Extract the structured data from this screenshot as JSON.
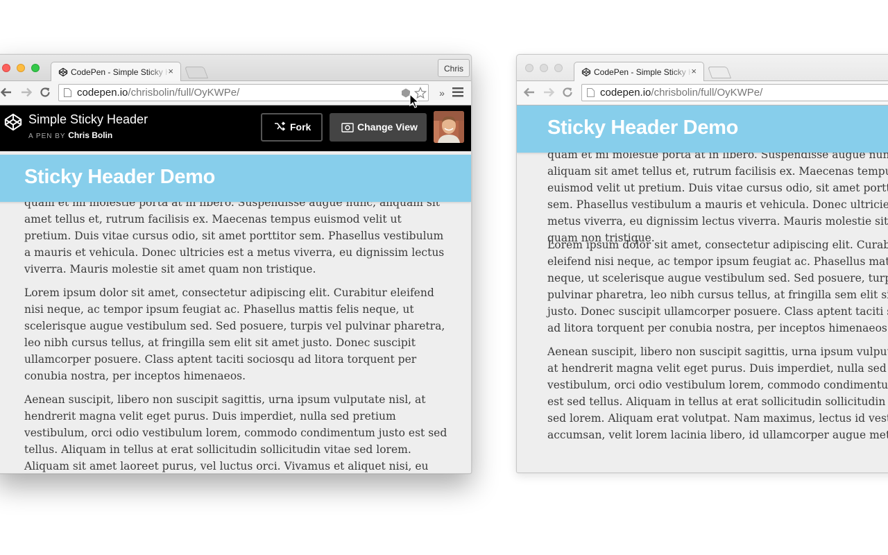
{
  "window_left": {
    "tab_title": "CodePen - Simple Sticky H",
    "tab_close": "×",
    "profile_name": "Chris",
    "url_host": "codepen.io",
    "url_path": "/chrisbolin/full/OyKWPe/",
    "overflow_label": "»",
    "codepen": {
      "title": "Simple Sticky Header",
      "by_label": "A PEN BY",
      "author": "Chris Bolin",
      "fork_label": "Fork",
      "change_view_label": "Change View"
    },
    "sticky_title": "Sticky Header Demo",
    "paragraphs": [
      "quam et mi molestie porta at in libero. Suspendisse augue nunc, aliquam sit amet tellus et, rutrum facilisis ex. Maecenas tempus euismod velit ut pretium. Duis vitae cursus odio, sit amet porttitor sem. Phasellus vestibulum a mauris et vehicula. Donec ultricies est a metus viverra, eu dignissim lectus viverra. Mauris molestie sit amet quam non tristique.",
      "Lorem ipsum dolor sit amet, consectetur adipiscing elit. Curabitur eleifend nisi neque, ac tempor ipsum feugiat ac. Phasellus mattis felis neque, ut scelerisque augue vestibulum sed. Sed posuere, turpis vel pulvinar pharetra, leo nibh cursus tellus, at fringilla sem elit sit amet justo. Donec suscipit ullamcorper posuere. Class aptent taciti sociosqu ad litora torquent per conubia nostra, per inceptos himenaeos.",
      "Aenean suscipit, libero non suscipit sagittis, urna ipsum vulputate nisl, at hendrerit magna velit eget purus. Duis imperdiet, nulla sed pretium vestibulum, orci odio vestibulum lorem, commodo condimentum justo est sed tellus. Aliquam in tellus at erat sollicitudin sollicitudin vitae sed lorem. Aliquam sit amet laoreet purus, vel luctus orci. Vivamus et aliquet nisi, eu cursus lectus. Vivamus"
    ]
  },
  "window_right": {
    "tab_title": "CodePen - Simple Sticky H",
    "tab_close": "×",
    "url_host": "codepen.io",
    "url_path": "/chrisbolin/full/OyKWPe/",
    "sticky_title": "Sticky Header Demo",
    "paragraphs": [
      "quam et mi molestie porta at in libero. Suspendisse augue nunc, aliquam sit amet tellus et, rutrum facilisis ex. Maecenas tempus euismod velit ut pretium. Duis vitae cursus odio, sit amet porttitor sem. Phasellus vestibulum a mauris et vehicula. Donec ultricies est a metus viverra, eu dignissim lectus viverra. Mauris molestie sit amet quam non tristique.",
      "Lorem ipsum dolor sit amet, consectetur adipiscing elit. Curabitur eleifend nisi neque, ac tempor ipsum feugiat ac. Phasellus mattis felis neque, ut scelerisque augue vestibulum sed. Sed posuere, turpis vel pulvinar pharetra, leo nibh cursus tellus, at fringilla sem elit sit amet justo. Donec suscipit ullamcorper posuere. Class aptent taciti sociosqu ad litora torquent per conubia nostra, per inceptos himenaeos.",
      "Aenean suscipit, libero non suscipit sagittis, urna ipsum vulputate nisl, at hendrerit magna velit eget purus. Duis imperdiet, nulla sed pretium vestibulum, orci odio vestibulum lorem, commodo condimentum justo est sed tellus. Aliquam in tellus at erat sollicitudin sollicitudin vitae sed lorem. Aliquam erat volutpat. Nam maximus, lectus id vestibulum accumsan, velit lorem lacinia libero, id ullamcorper augue metus quis"
    ]
  },
  "icons": {
    "back": "arrow-left-icon",
    "forward": "arrow-right-icon",
    "reload": "reload-icon",
    "menu": "hamburger-menu-icon",
    "star": "star-icon",
    "extension": "extension-icon",
    "codepen": "codepen-logo-icon",
    "fork": "fork-icon",
    "view": "eye-icon"
  },
  "colors": {
    "sticky_header_bg": "#87ceeb",
    "codepen_bar_bg": "#000000",
    "page_bg": "#eeeeee",
    "traffic_red": "#fc605c",
    "traffic_yellow": "#fdbc40",
    "traffic_green": "#34c84a"
  }
}
